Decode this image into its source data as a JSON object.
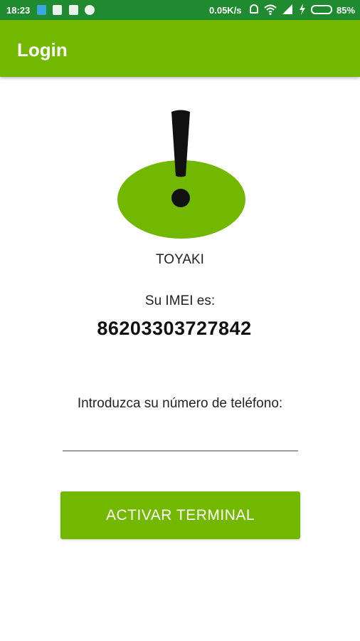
{
  "status_bar": {
    "time": "18:23",
    "net_speed": "0.05K/s",
    "battery_percent": "85%",
    "battery_level": 0.85,
    "icons": [
      "location-notification-icon",
      "sim-notification-icon",
      "app-notification-icon",
      "whatsapp-icon",
      "bell-muted-icon",
      "wifi-icon",
      "signal-icon",
      "charging-bolt-icon",
      "battery-icon"
    ]
  },
  "app_bar": {
    "title": "Login"
  },
  "logo": {
    "icon": "exclamation-oval-logo",
    "oval_color": "#72b800",
    "mark_color": "#111111"
  },
  "content": {
    "app_name": "TOYAKI",
    "imei_label": "Su IMEI es:",
    "imei_value": "86203303727842",
    "phone_label": "Introduzca su número de teléfono:",
    "phone_input_value": ""
  },
  "actions": {
    "activate_label": "ACTIVAR TERMINAL"
  },
  "colors": {
    "status_bar": "#1f8a2f",
    "primary": "#72b800",
    "text": "#222222"
  }
}
